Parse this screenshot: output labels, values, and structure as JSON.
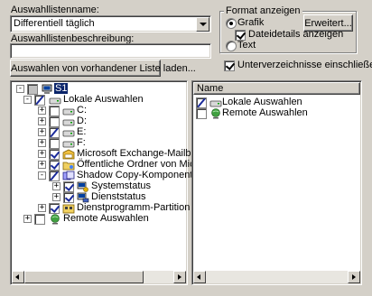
{
  "form": {
    "list_name_label": "Auswahllistenname:",
    "list_name_value": "Differentiell täglich",
    "description_label": "Auswahllistenbeschreibung:",
    "description_value": "",
    "load_button": "Auswahlen von vorhandener Liste laden..."
  },
  "format": {
    "group_title": "Format anzeigen",
    "grafik_label": "Grafik",
    "grafik_selected": true,
    "file_details_label": "Dateidetails anzeigen",
    "file_details_checked": true,
    "text_label": "Text",
    "text_selected": false,
    "advanced_button": "Erweitert..."
  },
  "subdirs": {
    "label": "Unterverzeichnisse einschließen",
    "checked": true
  },
  "tree": {
    "root": "S1",
    "items": [
      {
        "label": "Lokale Auswahlen",
        "expander": "-"
      },
      {
        "label": "C:",
        "expander": "+"
      },
      {
        "label": "D:",
        "expander": "+"
      },
      {
        "label": "E:",
        "expander": "+"
      },
      {
        "label": "F:",
        "expander": "+"
      },
      {
        "label": "Microsoft Exchange-Mailboxen",
        "expander": "+"
      },
      {
        "label": "Öffentliche Ordner von Microsoft E",
        "expander": "+"
      },
      {
        "label": "Shadow Copy-Komponenten",
        "expander": "-"
      },
      {
        "label": "Systemstatus",
        "expander": "+"
      },
      {
        "label": "Dienststatus",
        "expander": "+"
      },
      {
        "label": "Dienstprogramm-Partition",
        "expander": "+"
      },
      {
        "label": "Remote Auswahlen",
        "expander": "+"
      }
    ]
  },
  "list": {
    "column_header": "Name",
    "items": [
      {
        "label": "Lokale Auswahlen"
      },
      {
        "label": "Remote Auswahlen"
      }
    ]
  },
  "icons": {
    "drive": "drive-icon",
    "computer": "computer-icon",
    "mailbox": "mailbox-icon",
    "folder": "folder-icon",
    "shadow": "shadow-copy-icon",
    "system": "system-state-icon",
    "service": "service-state-icon",
    "utility": "utility-partition-icon",
    "remote": "remote-network-icon"
  }
}
